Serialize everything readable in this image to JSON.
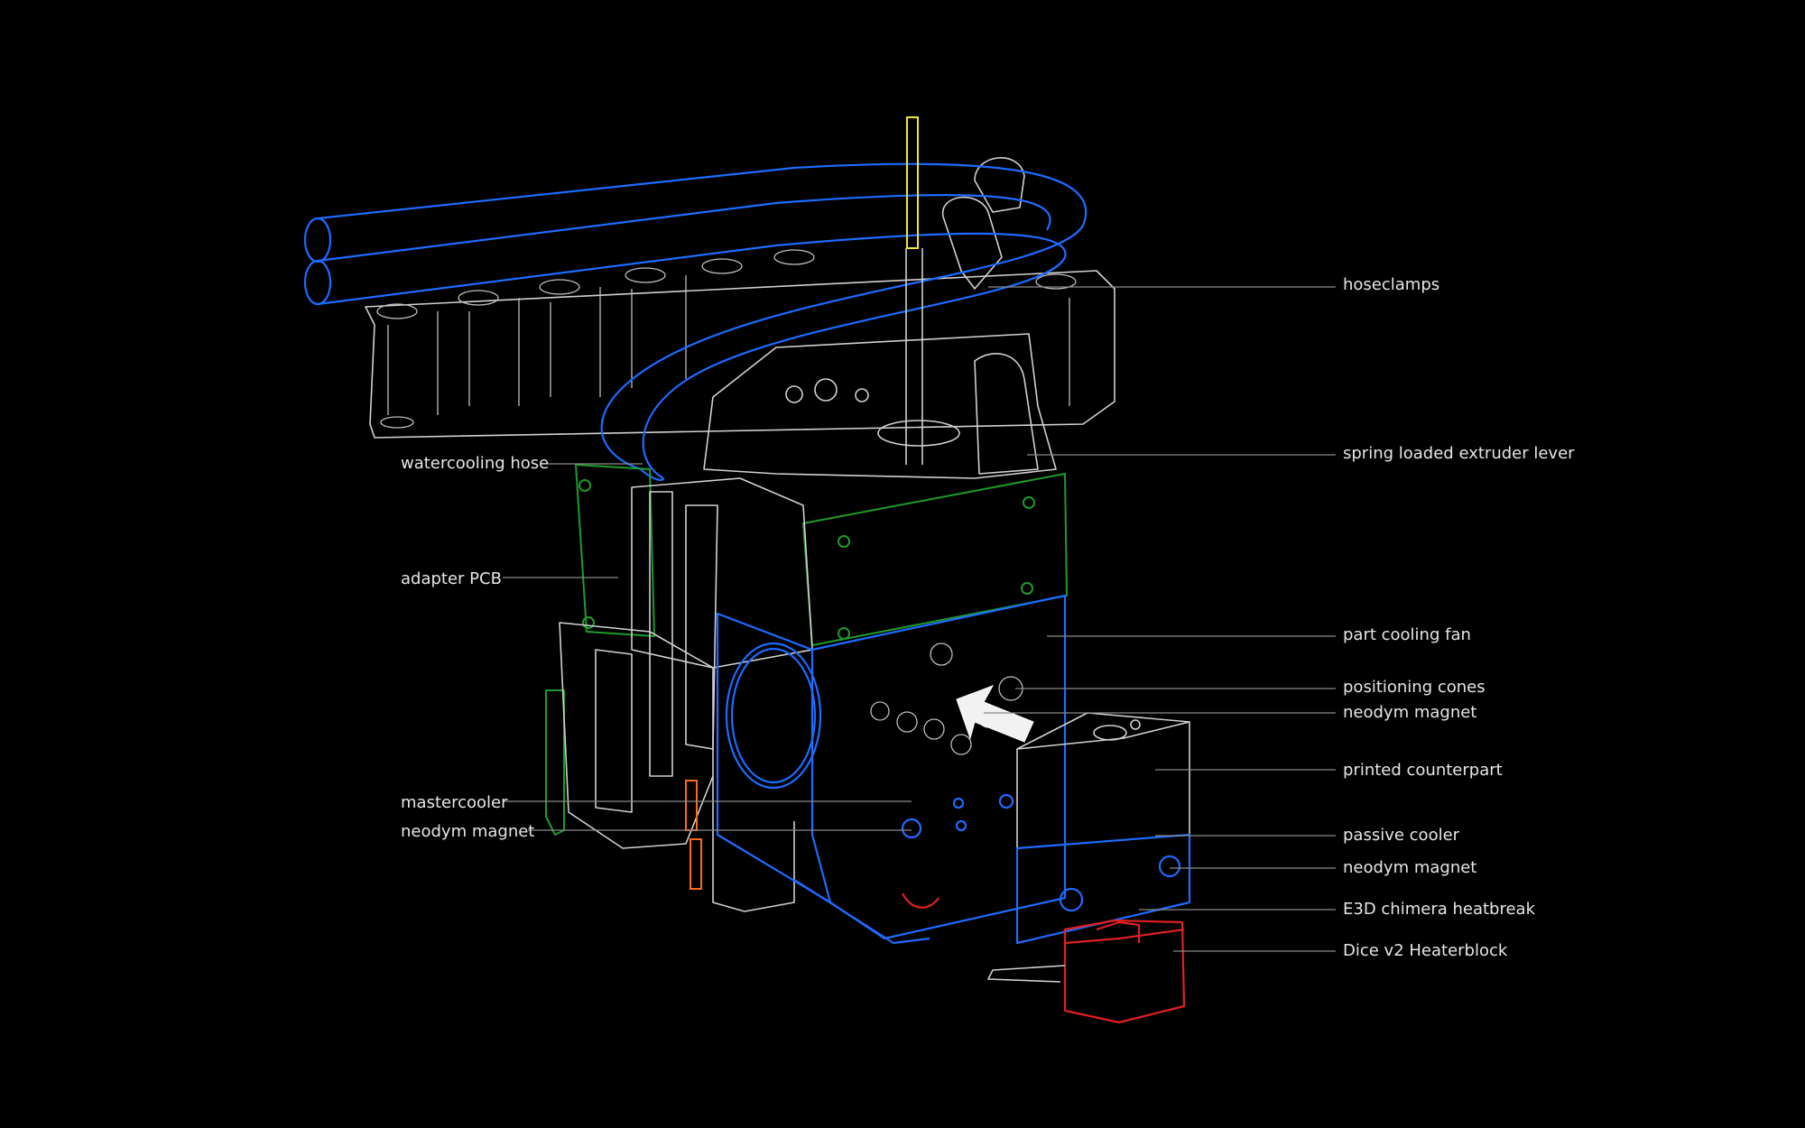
{
  "diagram": {
    "labels_left": [
      {
        "id": "watercooling-hose",
        "text": "watercooling hose"
      },
      {
        "id": "adapter-pcb",
        "text": "adapter PCB"
      },
      {
        "id": "mastercooler",
        "text": "mastercooler"
      },
      {
        "id": "neodym-magnet-left",
        "text": "neodym magnet"
      }
    ],
    "labels_right": [
      {
        "id": "hoseclamps",
        "text": "hoseclamps"
      },
      {
        "id": "spring-loaded-extruder-lever",
        "text": "spring loaded extruder lever"
      },
      {
        "id": "part-cooling-fan",
        "text": "part cooling fan"
      },
      {
        "id": "positioning-cones",
        "text": "positioning cones"
      },
      {
        "id": "neodym-magnet-right-1",
        "text": "neodym magnet"
      },
      {
        "id": "printed-counterpart",
        "text": "printed counterpart"
      },
      {
        "id": "passive-cooler",
        "text": "passive cooler"
      },
      {
        "id": "neodym-magnet-right-2",
        "text": "neodym magnet"
      },
      {
        "id": "e3d-chimera-heatbreak",
        "text": "E3D chimera heatbreak"
      },
      {
        "id": "dice-v2-heaterblock",
        "text": "Dice v2 Heaterblock"
      }
    ],
    "colors": {
      "background": "#000000",
      "label": "#e6e6e6",
      "leader": "#8a8a8a",
      "outline": "#d0d0d0",
      "blue_parts": "#1e6bff",
      "pcb_green": "#1f9a2a",
      "heaterblock_red": "#e02020",
      "filament_yellow": "#f0e82a",
      "magnet_orange": "#ff6a1a"
    }
  }
}
